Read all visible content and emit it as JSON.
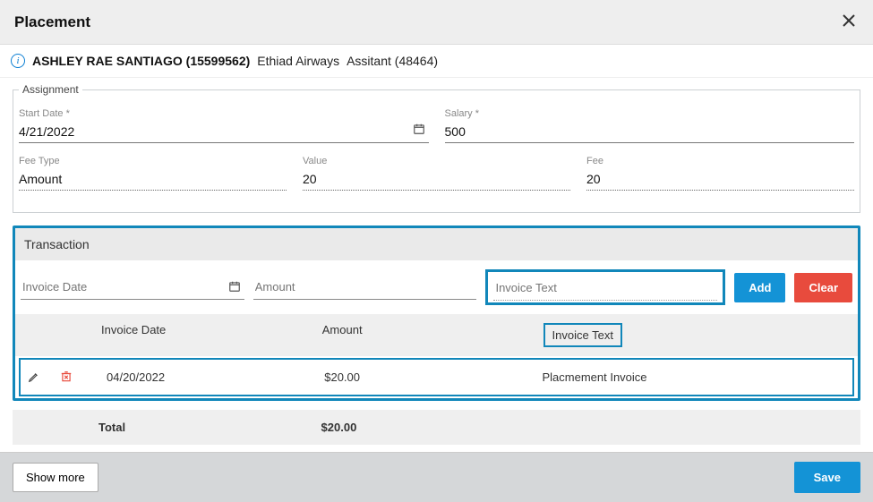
{
  "title": "Placement",
  "header": {
    "candidate": "ASHLEY RAE SANTIAGO (15599562)",
    "company": "Ethiad Airways",
    "position": "Assitant (48464)"
  },
  "assignment": {
    "legend": "Assignment",
    "start_date_label": "Start Date *",
    "start_date": "4/21/2022",
    "salary_label": "Salary *",
    "salary": "500",
    "fee_type_label": "Fee Type",
    "fee_type": "Amount",
    "value_label": "Value",
    "value": "20",
    "fee_label": "Fee",
    "fee": "20"
  },
  "transaction": {
    "heading": "Transaction",
    "invoice_date_ph": "Invoice Date",
    "amount_ph": "Amount",
    "invoice_text_ph": "Invoice Text",
    "add_label": "Add",
    "clear_label": "Clear",
    "columns": {
      "invoice_date": "Invoice Date",
      "amount": "Amount",
      "invoice_text": "Invoice Text"
    },
    "rows": [
      {
        "date": "04/20/2022",
        "amount": "$20.00",
        "text": "Placmement Invoice"
      }
    ],
    "total_label": "Total",
    "total_amount": "$20.00"
  },
  "footer": {
    "show_more": "Show more",
    "save": "Save"
  }
}
